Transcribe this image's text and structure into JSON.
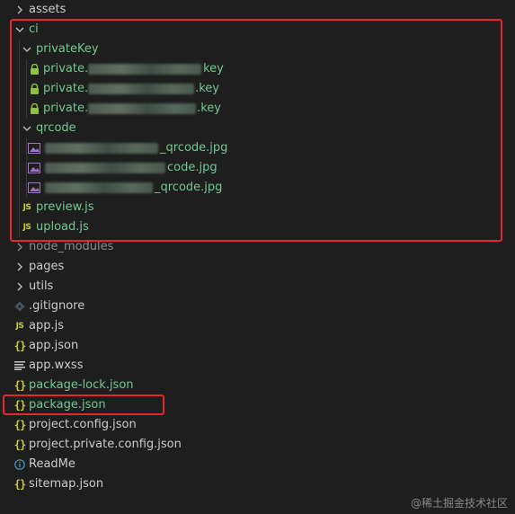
{
  "tree": {
    "assets": "assets",
    "ci": "ci",
    "privateKey": "privateKey",
    "key1_prefix": "private.",
    "key1_suffix": "key",
    "key2_prefix": "private.",
    "key2_suffix": ".key",
    "key3_prefix": "private.",
    "key3_suffix": ".key",
    "qrcode": "qrcode",
    "qr1_suffix": "_qrcode.jpg",
    "qr2_suffix": "code.jpg",
    "qr3_suffix": "_qrcode.jpg",
    "preview": "preview.js",
    "upload": "upload.js",
    "node_modules": "node_modules",
    "pages": "pages",
    "utils": "utils",
    "gitignore": ".gitignore",
    "appjs": "app.js",
    "appjson": "app.json",
    "appwxss": "app.wxss",
    "packagelock": "package-lock.json",
    "packagejson": "package.json",
    "projectconfig": "project.config.json",
    "projectprivate": "project.private.config.json",
    "readme": "ReadMe",
    "sitemap": "sitemap.json"
  },
  "icons": {
    "js": "JS",
    "json": "{}"
  },
  "colors": {
    "default_text": "#cccccc",
    "git_untracked": "#73c991",
    "gitignored": "#8c8c8c",
    "lock": "#8dc149",
    "js_icon": "#cbcb41",
    "json_icon": "#cbcb41",
    "image_icon": "#a074c4",
    "highlight": "#e5262d"
  },
  "watermark": "@稀土掘金技术社区"
}
